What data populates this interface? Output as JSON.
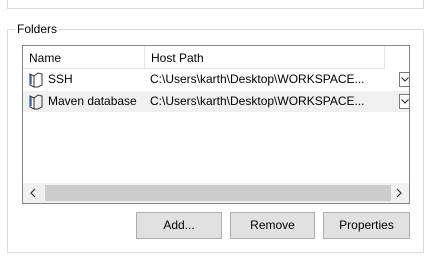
{
  "group": {
    "title": "Folders"
  },
  "columns": {
    "name": "Name",
    "host_path": "Host Path"
  },
  "rows": [
    {
      "name": "SSH",
      "path": "C:\\Users\\karth\\Desktop\\WORKSPACE...",
      "icon": "shared-folder-icon",
      "selected": false
    },
    {
      "name": "Maven database",
      "path": "C:\\Users\\karth\\Desktop\\WORKSPACE...",
      "icon": "shared-folder-icon",
      "selected": true
    }
  ],
  "buttons": {
    "add": "Add...",
    "remove": "Remove",
    "properties": "Properties"
  }
}
